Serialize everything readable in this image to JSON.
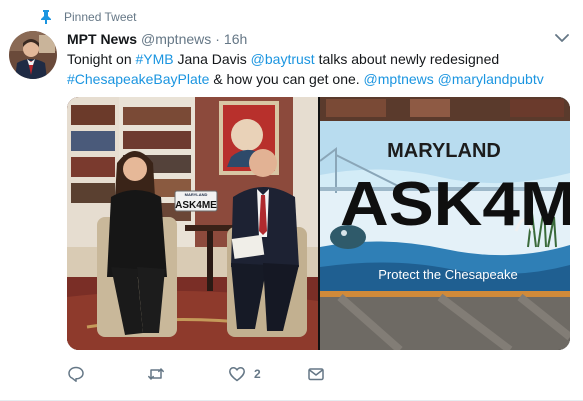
{
  "pinned": {
    "label": "Pinned Tweet",
    "icon": "pin-icon"
  },
  "author": {
    "name": "MPT News",
    "handle": "@mptnews",
    "separator": "·",
    "time": "16h"
  },
  "tweet": {
    "t1": "Tonight on ",
    "l1": "#YMB",
    "t2": " Jana Davis ",
    "l2": "@baytrust",
    "t3": " talks about newly redesigned",
    "l3": "#ChesapeakeBayPlate",
    "t4": " & how you can get one. ",
    "l4": "@mptnews",
    "t5": " ",
    "l5": "@marylandpubtv"
  },
  "media": {
    "left_plate": {
      "state": "MARYLAND",
      "number": "ASK4ME"
    },
    "right_plate": {
      "state": "MARYLAND",
      "number": "ASK4M",
      "tagline": "Protect the Chesapeake"
    }
  },
  "actions": {
    "reply": {
      "icon": "reply-icon"
    },
    "retweet": {
      "icon": "retweet-icon"
    },
    "like": {
      "icon": "heart-icon",
      "count": "2"
    },
    "dm": {
      "icon": "envelope-icon"
    }
  },
  "colors": {
    "link": "#1b95e0",
    "secondary": "#657786",
    "text": "#14171a"
  }
}
